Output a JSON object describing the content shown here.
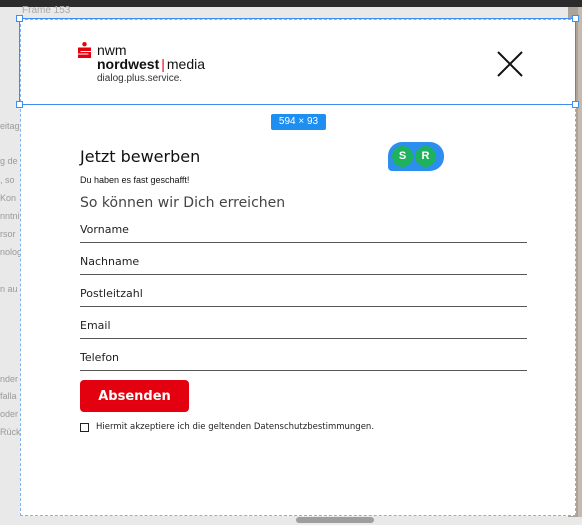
{
  "canvas": {
    "frame_label": "Frame 153",
    "size_badge": "594 × 93",
    "background_fragments": [
      "eitag",
      "g de",
      ", so",
      "Kon",
      "nntni",
      "rsor",
      "nolog",
      "n au",
      "nder",
      "falla",
      "oder",
      "Rück"
    ]
  },
  "header": {
    "logo": {
      "line1": "nwm",
      "line2_bold": "nordwest",
      "line2_sep": "|",
      "line2_rest": "media",
      "tagline": "dialog.plus.service."
    },
    "close_icon": "close-icon"
  },
  "collaborators": {
    "avatars": [
      "S",
      "R"
    ]
  },
  "form": {
    "title": "Jetzt bewerben",
    "subtitle": "Du haben es fast geschafft!",
    "section_title": "So können wir Dich erreichen",
    "fields": [
      {
        "placeholder": "Vorname",
        "value": ""
      },
      {
        "placeholder": "Nachname",
        "value": ""
      },
      {
        "placeholder": "Postleitzahl",
        "value": ""
      },
      {
        "placeholder": "Email",
        "value": ""
      },
      {
        "placeholder": "Telefon",
        "value": ""
      }
    ],
    "submit_label": "Absenden",
    "consent_label": "Hiermit akzeptiere ich die geltenden Datenschutzbestimmungen.",
    "consent_checked": false
  },
  "colors": {
    "brand_red": "#e3000f",
    "selection_blue": "#3d8ef0",
    "avatar_green": "#1fb25e"
  }
}
